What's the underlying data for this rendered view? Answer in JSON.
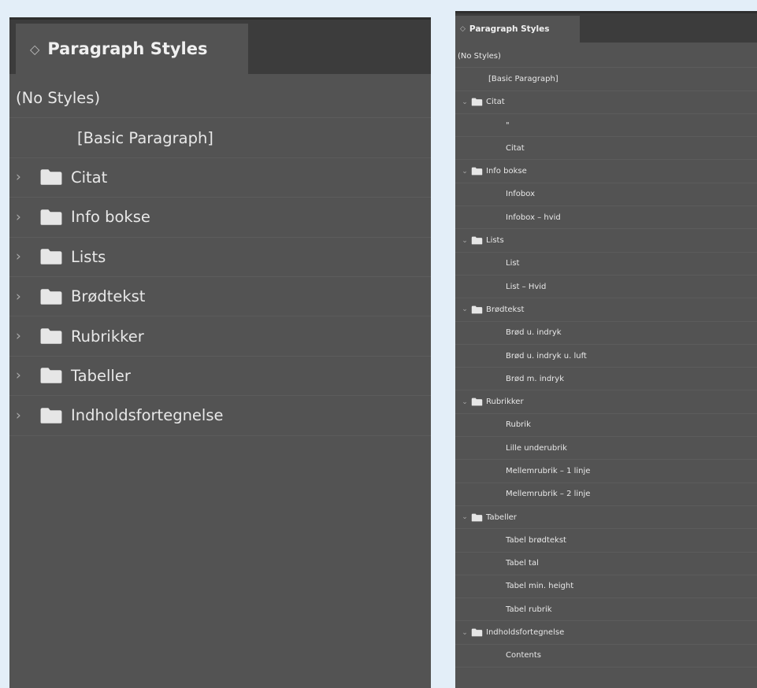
{
  "colors": {
    "background": "#e3eef8",
    "panel": "#535353",
    "tabbar": "#3c3c3c",
    "text": "#e8e8e8"
  },
  "left_panel": {
    "tab_icon": "◇",
    "tab_label": "Paragraph Styles",
    "no_styles": "(No Styles)",
    "basic_paragraph": "[Basic Paragraph]",
    "groups": [
      {
        "chevron": "›",
        "label": "Citat"
      },
      {
        "chevron": "›",
        "label": "Info bokse"
      },
      {
        "chevron": "›",
        "label": "Lists"
      },
      {
        "chevron": "›",
        "label": "Brødtekst"
      },
      {
        "chevron": "›",
        "label": "Rubrikker"
      },
      {
        "chevron": "›",
        "label": "Tabeller"
      },
      {
        "chevron": "›",
        "label": "Indholdsfortegnelse"
      }
    ]
  },
  "right_panel": {
    "tab_icon": "◇",
    "tab_label": "Paragraph Styles",
    "no_styles": "(No Styles)",
    "basic_paragraph": "[Basic Paragraph]",
    "groups": [
      {
        "chevron": "⌄",
        "label": "Citat",
        "items": [
          "\"",
          "Citat"
        ]
      },
      {
        "chevron": "⌄",
        "label": "Info bokse",
        "items": [
          "Infobox",
          "Infobox – hvid"
        ]
      },
      {
        "chevron": "⌄",
        "label": "Lists",
        "items": [
          "List",
          "List – Hvid"
        ]
      },
      {
        "chevron": "⌄",
        "label": "Brødtekst",
        "items": [
          "Brød u. indryk",
          "Brød u. indryk u. luft",
          "Brød m. indryk"
        ]
      },
      {
        "chevron": "⌄",
        "label": "Rubrikker",
        "items": [
          "Rubrik",
          "Lille underubrik",
          "Mellemrubrik – 1 linje",
          "Mellemrubrik – 2 linje"
        ]
      },
      {
        "chevron": "⌄",
        "label": "Tabeller",
        "items": [
          "Tabel brødtekst",
          "Tabel tal",
          "Tabel min. height",
          "Tabel rubrik"
        ]
      },
      {
        "chevron": "⌄",
        "label": "Indholdsfortegnelse",
        "items": [
          "Contents"
        ]
      }
    ]
  }
}
